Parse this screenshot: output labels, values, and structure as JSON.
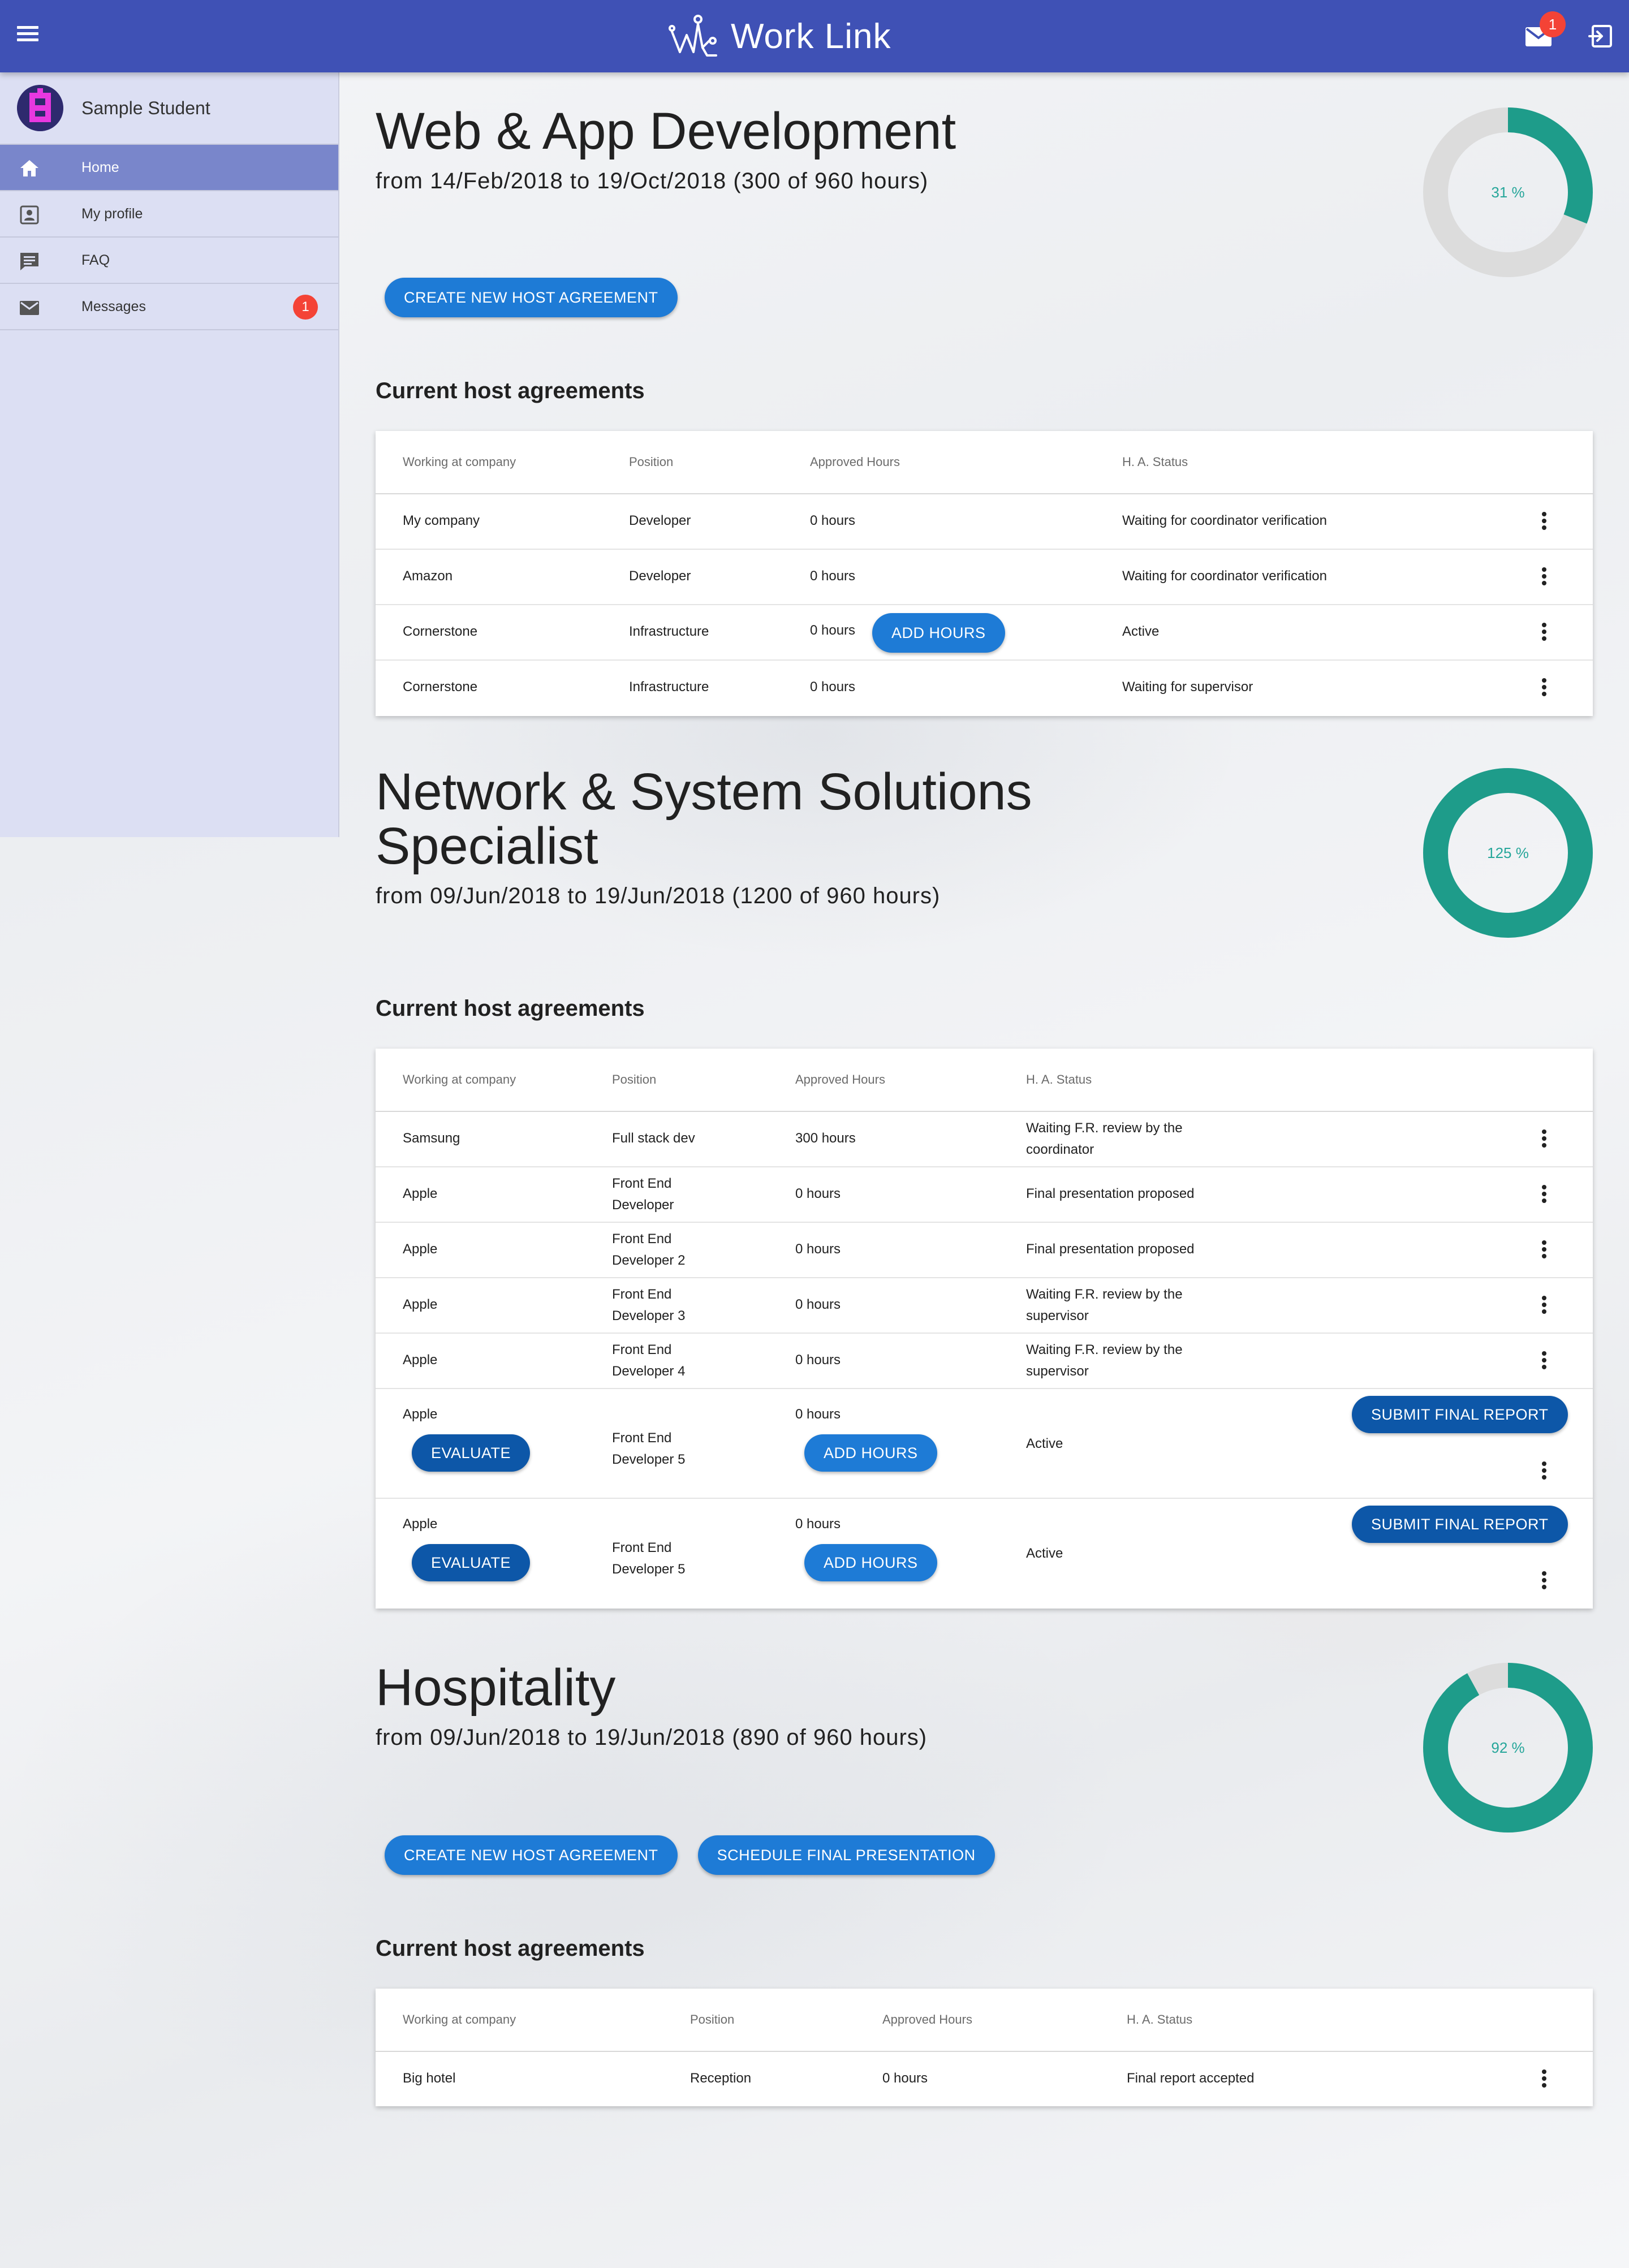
{
  "app": {
    "title": "Work Link",
    "accent": "#3f51b5",
    "mail_count": "1"
  },
  "sidebar": {
    "user_name": "Sample Student",
    "items": [
      {
        "label": "Home",
        "icon": "home-icon",
        "active": true
      },
      {
        "label": "My profile",
        "icon": "profile-icon"
      },
      {
        "label": "FAQ",
        "icon": "faq-icon"
      },
      {
        "label": "Messages",
        "icon": "mail-icon",
        "badge": "1"
      }
    ]
  },
  "table_headers": {
    "company": "Working at company",
    "position": "Position",
    "hours": "Approved Hours",
    "status": "H. A. Status"
  },
  "programs": [
    {
      "title": "Web & App Development",
      "dates": "from 14/Feb/2018 to 19/Oct/2018 (300 of 960 hours)",
      "progress_label": "31 %",
      "progress": 0.31,
      "buttons": [
        "CREATE NEW HOST AGREEMENT"
      ],
      "section_title": "Current host agreements",
      "rows": [
        {
          "company": "My company",
          "position": "Developer",
          "hours": "0 hours",
          "status": "Waiting for coordinator verification"
        },
        {
          "company": "Amazon",
          "position": "Developer",
          "hours": "0 hours",
          "status": "Waiting for coordinator verification"
        },
        {
          "company": "Cornerstone",
          "position": "Infrastructure",
          "hours": "0 hours",
          "status": "Active",
          "add_hours": "ADD HOURS"
        },
        {
          "company": "Cornerstone",
          "position": "Infrastructure",
          "hours": "0 hours",
          "status": "Waiting for supervisor"
        }
      ]
    },
    {
      "title": "Network & System Solutions Specialist",
      "dates": "from 09/Jun/2018 to 19/Jun/2018 (1200 of 960 hours)",
      "progress_label": "125 %",
      "progress": 1.25,
      "buttons": [],
      "section_title": "Current host agreements",
      "rows": [
        {
          "company": "Samsung",
          "position": "Full stack dev",
          "hours": "300 hours",
          "status": "Waiting F.R. review by the coordinator"
        },
        {
          "company": "Apple",
          "position": "Front End Developer",
          "hours": "0 hours",
          "status": "Final presentation proposed"
        },
        {
          "company": "Apple",
          "position": "Front End Developer 2",
          "hours": "0 hours",
          "status": "Final presentation proposed"
        },
        {
          "company": "Apple",
          "position": "Front End Developer 3",
          "hours": "0 hours",
          "status": "Waiting F.R. review by the supervisor"
        },
        {
          "company": "Apple",
          "position": "Front End Developer 4",
          "hours": "0 hours",
          "status": "Waiting F.R. review by the supervisor"
        },
        {
          "company": "Apple",
          "position": "Front End Developer 5",
          "hours": "0 hours",
          "status": "Active",
          "evaluate": "EVALUATE",
          "add_hours": "ADD HOURS",
          "submit": "SUBMIT FINAL REPORT"
        },
        {
          "company": "Apple",
          "position": "Front End Developer 5",
          "hours": "0 hours",
          "status": "Active",
          "evaluate": "EVALUATE",
          "add_hours": "ADD HOURS",
          "submit": "SUBMIT FINAL REPORT"
        }
      ]
    },
    {
      "title": "Hospitality",
      "dates": "from 09/Jun/2018 to 19/Jun/2018 (890 of 960 hours)",
      "progress_label": "92 %",
      "progress": 0.92,
      "buttons": [
        "CREATE NEW HOST AGREEMENT",
        "SCHEDULE FINAL PRESENTATION"
      ],
      "section_title": "Current host agreements",
      "rows": [
        {
          "company": "Big hotel",
          "position": "Reception",
          "hours": "0 hours",
          "status": "Final report accepted"
        }
      ]
    }
  ],
  "colors": {
    "progress": "#1e9c8a",
    "track": "#dcdcdc",
    "button": "#1e7bd6",
    "button_dark": "#0d57a8",
    "badge": "#f44336"
  }
}
